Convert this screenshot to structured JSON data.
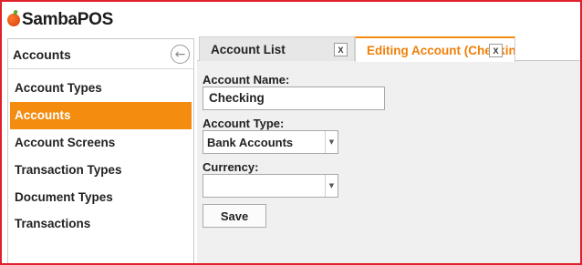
{
  "app": {
    "logo_text": "SambaPOS"
  },
  "sidebar": {
    "title": "Accounts",
    "back_icon": "arrow-left-circle-icon",
    "items": [
      {
        "label": "Account Types",
        "active": false
      },
      {
        "label": "Accounts",
        "active": true
      },
      {
        "label": "Account Screens",
        "active": false
      },
      {
        "label": "Transaction Types",
        "active": false
      },
      {
        "label": "Document Types",
        "active": false
      },
      {
        "label": "Transactions",
        "active": false
      }
    ]
  },
  "tabs": [
    {
      "label": "Account List",
      "close": "X",
      "active": false
    },
    {
      "label": "Editing Account (Checking)",
      "close": "X",
      "active": true
    }
  ],
  "form": {
    "name_label": "Account Name:",
    "name_value": "Checking",
    "type_label": "Account Type:",
    "type_value": "Bank Accounts",
    "currency_label": "Currency:",
    "currency_value": "",
    "save_label": "Save"
  },
  "colors": {
    "accent": "#f38c0f",
    "frame": "#e0202a",
    "panel": "#f0f0f0"
  }
}
